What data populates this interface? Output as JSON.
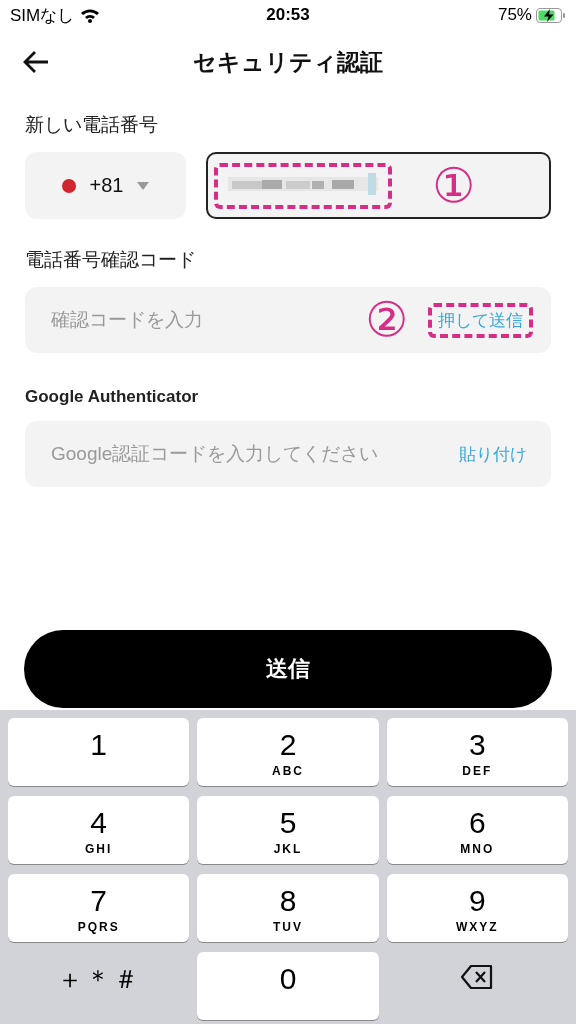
{
  "status_bar": {
    "carrier": "SIMなし",
    "time": "20:53",
    "battery": "75%"
  },
  "header": {
    "title": "セキュリティ認証"
  },
  "phone": {
    "label": "新しい電話番号",
    "country_code": "+81",
    "number_annotation": "①"
  },
  "sms_code": {
    "label": "電話番号確認コード",
    "placeholder": "確認コードを入力",
    "action": "押して送信",
    "action_annotation": "②"
  },
  "google_code": {
    "label": "Google Authenticator",
    "placeholder": "Google認証コードを入力してください",
    "action": "貼り付け"
  },
  "submit": "送信",
  "keypad": [
    {
      "kind": "digit",
      "digit": "1"
    },
    {
      "kind": "digit",
      "digit": "2",
      "letters": "ABC"
    },
    {
      "kind": "digit",
      "digit": "3",
      "letters": "DEF"
    },
    {
      "kind": "digit",
      "digit": "4",
      "letters": "GHI"
    },
    {
      "kind": "digit",
      "digit": "5",
      "letters": "JKL"
    },
    {
      "kind": "digit",
      "digit": "6",
      "letters": "MNO"
    },
    {
      "kind": "digit",
      "digit": "7",
      "letters": "PQRS"
    },
    {
      "kind": "digit",
      "digit": "8",
      "letters": "TUV"
    },
    {
      "kind": "digit",
      "digit": "9",
      "letters": "WXYZ"
    },
    {
      "kind": "symbols",
      "digit": "＋＊＃"
    },
    {
      "kind": "digit",
      "digit": "0"
    },
    {
      "kind": "delete"
    }
  ]
}
